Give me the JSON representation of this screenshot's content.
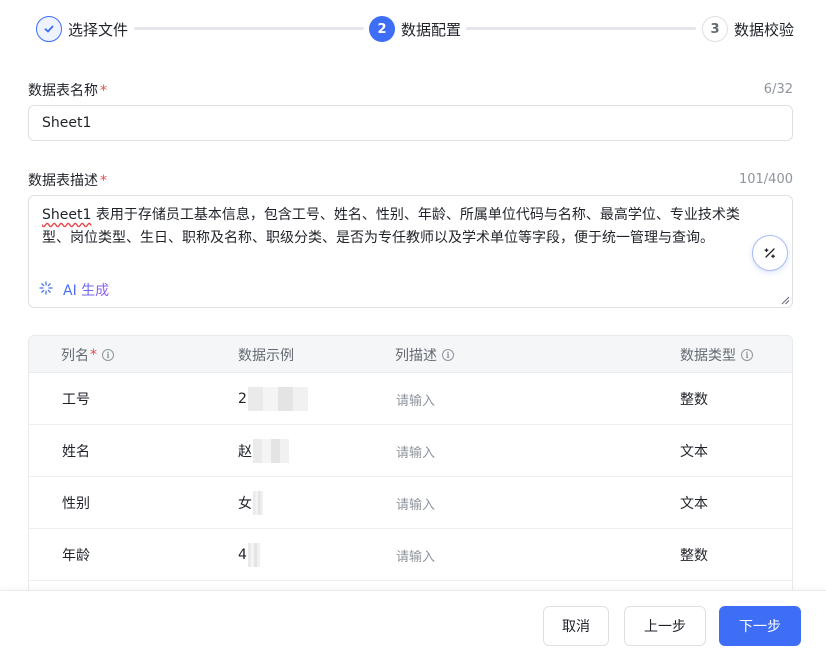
{
  "stepper": {
    "steps": [
      {
        "number": "",
        "label": "选择文件",
        "state": "done"
      },
      {
        "number": "2",
        "label": "数据配置",
        "state": "active"
      },
      {
        "number": "3",
        "label": "数据校验",
        "state": "pending"
      }
    ]
  },
  "form": {
    "name_label": "数据表名称",
    "name_counter": "6/32",
    "name_value": "Sheet1",
    "desc_label": "数据表描述",
    "desc_counter": "101/400",
    "desc_value_prefix": "Sheet1",
    "desc_value_rest": " 表用于存储员工基本信息，包含工号、姓名、性别、年龄、所属单位代码与名称、最高学位、专业技术类型、岗位类型、生日、职称及名称、职级分类、是否为专任教师以及学术单位等字段，便于统一管理与查询。",
    "ai_generate_label": "AI 生成",
    "required_mark": "*"
  },
  "table": {
    "headers": {
      "name": "列名",
      "sample": "数据示例",
      "desc": "列描述",
      "type": "数据类型"
    },
    "rows": [
      {
        "name": "工号",
        "sample": "2",
        "desc_placeholder": "请输入",
        "type": "整数"
      },
      {
        "name": "姓名",
        "sample": "赵",
        "desc_placeholder": "请输入",
        "type": "文本"
      },
      {
        "name": "性别",
        "sample": "女",
        "desc_placeholder": "请输入",
        "type": "文本"
      },
      {
        "name": "年龄",
        "sample": "4",
        "desc_placeholder": "请输入",
        "type": "整数"
      }
    ]
  },
  "footer": {
    "cancel_label": "取消",
    "prev_label": "上一步",
    "next_label": "下一步"
  },
  "colors": {
    "accent": "#3d6ef5",
    "required": "#e5484d"
  }
}
